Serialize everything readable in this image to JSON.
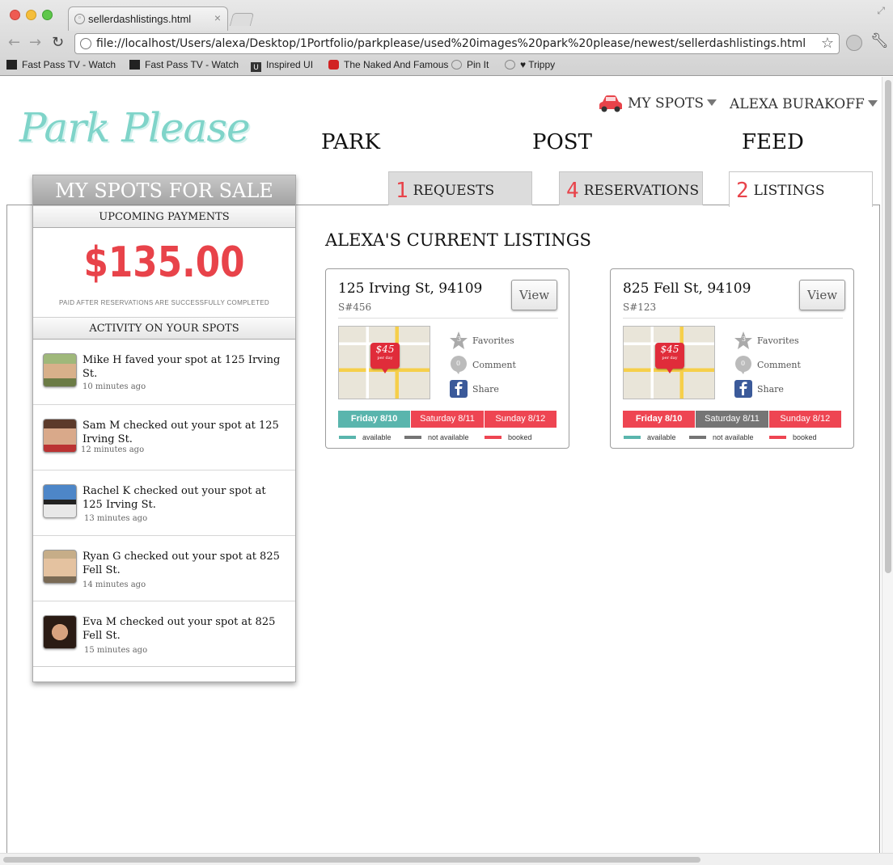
{
  "browser": {
    "tab_title": "sellerdashlistings.html",
    "url": "file://localhost/Users/alexa/Desktop/1Portfolio/parkplease/used%20images%20park%20please/newest/sellerdashlistings.html",
    "bookmarks": [
      "Fast Pass TV - Watch",
      "Fast Pass TV - Watch",
      "Inspired UI",
      "The Naked And Famous",
      "Pin It",
      "♥ Trippy"
    ]
  },
  "header": {
    "logo": "Park Please",
    "my_spots": "MY SPOTS",
    "user": "ALEXA BURAKOFF",
    "nav": [
      "PARK",
      "POST",
      "FEED"
    ]
  },
  "tabs": [
    {
      "count": "1",
      "label": "REQUESTS"
    },
    {
      "count": "4",
      "label": "RESERVATIONS"
    },
    {
      "count": "2",
      "label": "LISTINGS"
    }
  ],
  "sidebar": {
    "title": "MY SPOTS FOR SALE",
    "payments_header": "UPCOMING PAYMENTS",
    "amount": "$135.00",
    "payment_note": "PAID AFTER RESERVATIONS ARE SUCCESSFULLY COMPLETED",
    "activity_header": "ACTIVITY ON YOUR SPOTS",
    "activity": [
      {
        "text": "Mike H faved your spot at 125 Irving St.",
        "time": "10 minutes ago"
      },
      {
        "text": "Sam M checked out your spot at 125 Irving St.",
        "time": "12 minutes ago"
      },
      {
        "text": "Rachel K checked out your spot at 125 Irving St.",
        "time": "13 minutes ago"
      },
      {
        "text": "Ryan G checked out your spot at 825 Fell St.",
        "time": "14 minutes ago"
      },
      {
        "text": "Eva M checked out your spot at 825 Fell St.",
        "time": "15 minutes ago"
      }
    ]
  },
  "main": {
    "title": "ALEXA'S CURRENT LISTINGS",
    "listings": [
      {
        "address": "125 Irving St, 94109",
        "spot_id": "S#456",
        "view_label": "View",
        "price": "$45",
        "price_unit": "per day",
        "favorites_count": "3",
        "favorites_label": "Favorites",
        "comment_count": "0",
        "comment_label": "Comment",
        "share_label": "Share",
        "days": [
          {
            "label": "Friday 8/10",
            "status": "available"
          },
          {
            "label": "Saturday 8/11",
            "status": "booked"
          },
          {
            "label": "Sunday 8/12",
            "status": "booked"
          }
        ]
      },
      {
        "address": "825 Fell St, 94109",
        "spot_id": "S#123",
        "view_label": "View",
        "price": "$45",
        "price_unit": "per day",
        "favorites_count": "3",
        "favorites_label": "Favorites",
        "comment_count": "0",
        "comment_label": "Comment",
        "share_label": "Share",
        "days": [
          {
            "label": "Friday 8/10",
            "status": "booked"
          },
          {
            "label": "Saturday 8/11",
            "status": "not available"
          },
          {
            "label": "Sunday 8/12",
            "status": "booked"
          }
        ]
      }
    ],
    "legend": [
      "available",
      "not available",
      "booked"
    ]
  },
  "colors": {
    "available": "#5ab5ad",
    "not_available": "#757575",
    "booked": "#ee4552",
    "accent_red": "#e8434a",
    "logo_teal": "#7fd4c9"
  }
}
